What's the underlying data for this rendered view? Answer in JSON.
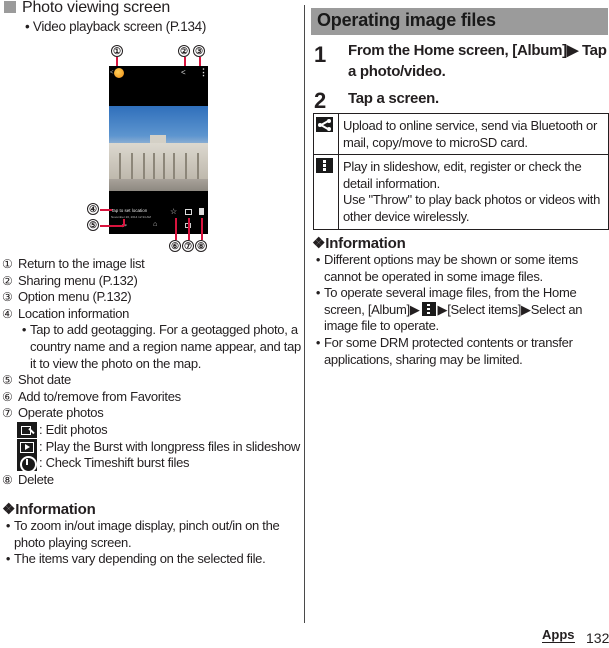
{
  "left": {
    "section_title": "Photo viewing screen",
    "sub_bullet": "Video playback screen (P.134)",
    "callouts": [
      "①",
      "②",
      "③",
      "④",
      "⑤",
      "⑥",
      "⑦",
      "⑧"
    ],
    "phone_screen": {
      "location_text": "Tap to set location",
      "date_text": "November 20, 2014 12:34 AM"
    },
    "legend": [
      {
        "num": "①",
        "text": "Return to the image list"
      },
      {
        "num": "②",
        "text": "Sharing menu (P.132)"
      },
      {
        "num": "③",
        "text": "Option menu (P.132)"
      },
      {
        "num": "④",
        "text": "Location information"
      },
      {
        "num": "⑤",
        "text": "Shot date"
      },
      {
        "num": "⑥",
        "text": "Add to/remove from Favorites"
      },
      {
        "num": "⑦",
        "text": "Operate photos"
      },
      {
        "num": "⑧",
        "text": "Delete"
      }
    ],
    "location_note": "Tap to add geotagging. For a geotagged photo, a country name and a region name appear, and tap it to view the photo on the map.",
    "operate_options": [
      {
        "icon": "edit-photo-icon",
        "text": ": Edit photos"
      },
      {
        "icon": "slideshow-icon",
        "text": ": Play the Burst with longpress files in slideshow"
      },
      {
        "icon": "timeshift-icon",
        "text": ": Check Timeshift burst files"
      }
    ],
    "information": {
      "title": "❖Information",
      "bullets": [
        "To zoom in/out image display, pinch out/in on the photo playing screen.",
        "The items vary depending on the selected file."
      ]
    }
  },
  "right": {
    "section_title": "Operating image files",
    "steps": [
      {
        "num": "1",
        "text": "From the Home screen, [Album]▶ Tap a photo/video."
      },
      {
        "num": "2",
        "text": "Tap a screen."
      }
    ],
    "table": [
      {
        "icon": "share-icon",
        "desc": [
          "Upload to online service, send via Bluetooth or mail, copy/move to microSD card."
        ]
      },
      {
        "icon": "menu-icon",
        "desc": [
          "Play in slideshow, edit, register or check the detail information.",
          "Use \"Throw\" to play back photos or videos with other device wirelessly."
        ]
      }
    ],
    "information": {
      "title": "❖Information",
      "bullets": [
        "Different options may be shown or some items cannot be operated in some image files.",
        "To operate several image files, from the Home screen, [Album]▶",
        "▶[Select items]▶Select an image file to operate.",
        "For some DRM protected contents or transfer applications, sharing may be limited."
      ]
    }
  },
  "footer": {
    "section": "Apps",
    "page": "132"
  },
  "bullet_char": "•"
}
